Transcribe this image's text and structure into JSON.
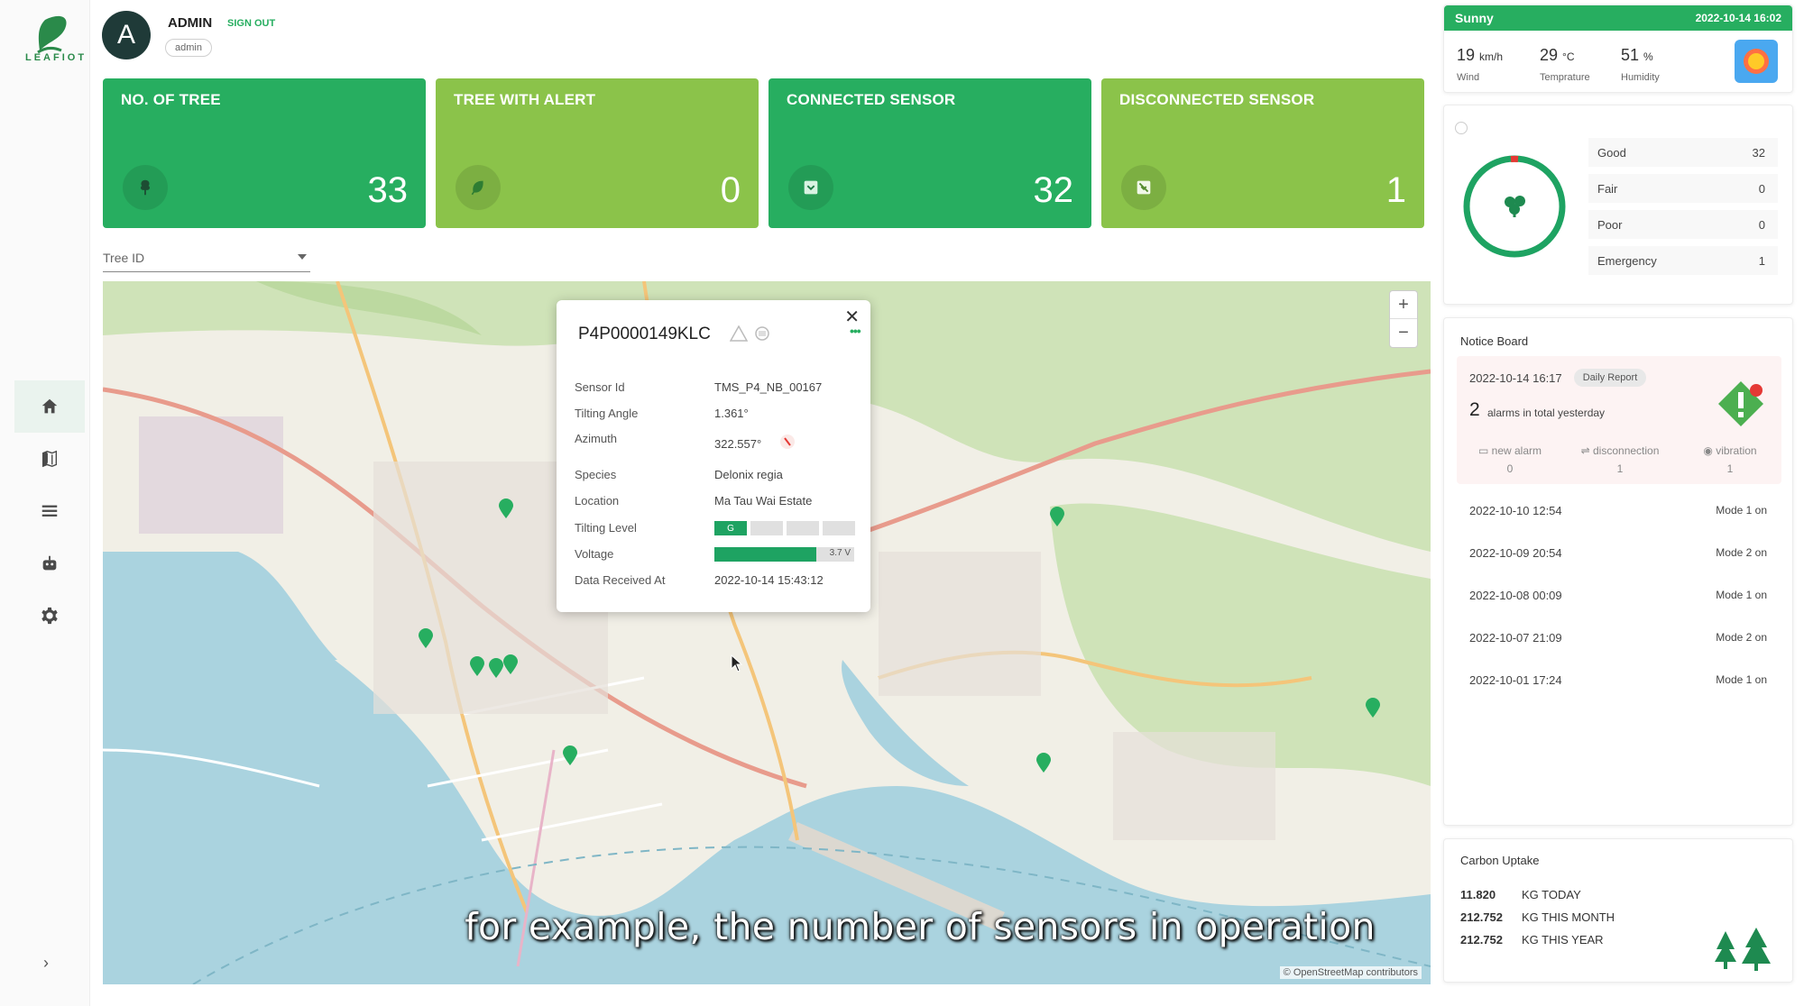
{
  "app": {
    "logo_text": "LEAFIOT"
  },
  "user": {
    "initial": "A",
    "name": "ADMIN",
    "sign_out": "SIGN OUT",
    "role": "admin"
  },
  "nav": [
    {
      "name": "home",
      "icon": "home-icon",
      "active": true
    },
    {
      "name": "map",
      "icon": "map-icon"
    },
    {
      "name": "list",
      "icon": "list-icon"
    },
    {
      "name": "sensor",
      "icon": "robot-icon"
    },
    {
      "name": "settings",
      "icon": "gear-icon"
    }
  ],
  "stats": [
    {
      "title": "NO. OF TREE",
      "value": "33",
      "icon": "tree-icon",
      "tone": "dark"
    },
    {
      "title": "TREE WITH ALERT",
      "value": "0",
      "icon": "leaf-alert-icon",
      "tone": "light"
    },
    {
      "title": "CONNECTED SENSOR",
      "value": "32",
      "icon": "sensor-icon",
      "tone": "dark"
    },
    {
      "title": "DISCONNECTED SENSOR",
      "value": "1",
      "icon": "sensor-off-icon",
      "tone": "light"
    }
  ],
  "tree_select": {
    "label": "Tree ID"
  },
  "map": {
    "zoom_in": "+",
    "zoom_out": "−",
    "attribution": "© OpenStreetMap contributors",
    "popup": {
      "title": "P4P0000149KLC",
      "close": "✕",
      "more": "•••",
      "rows": [
        {
          "label": "Sensor Id",
          "value": "TMS_P4_NB_00167"
        },
        {
          "label": "Tilting Angle",
          "value": "1.361°"
        },
        {
          "label": "Azimuth",
          "value": "322.557°"
        },
        {
          "label": "Species",
          "value": "Delonix regia"
        },
        {
          "label": "Location",
          "value": "Ma Tau Wai Estate"
        },
        {
          "label": "Tilting Level",
          "value": ""
        },
        {
          "label": "Voltage",
          "value": ""
        },
        {
          "label": "Data Received At",
          "value": "2022-10-14 15:43:12"
        }
      ],
      "tilt_level": {
        "segments": [
          "G",
          "",
          "",
          ""
        ],
        "active_index": 0
      },
      "voltage": {
        "value": "3.7 V",
        "fill_fraction": 0.73
      }
    }
  },
  "subtitle": "for example, the number of sensors in operation",
  "weather": {
    "condition": "Sunny",
    "datetime": "2022-10-14 16:02",
    "items": [
      {
        "value": "19",
        "unit": "km/h",
        "label": "Wind"
      },
      {
        "value": "29",
        "unit": "°C",
        "label": "Temprature"
      },
      {
        "value": "51",
        "unit": "%",
        "label": "Humidity"
      }
    ]
  },
  "tree_status": {
    "rows": [
      {
        "label": "Good",
        "value": "32"
      },
      {
        "label": "Fair",
        "value": "0"
      },
      {
        "label": "Poor",
        "value": "0"
      },
      {
        "label": "Emergency",
        "value": "1"
      }
    ]
  },
  "notice_board": {
    "title": "Notice Board",
    "highlight": {
      "time": "2022-10-14 16:17",
      "chip": "Daily Report",
      "count": "2",
      "count_text": "alarms in total yesterday",
      "categories": [
        {
          "label": "new alarm",
          "value": "0"
        },
        {
          "label": "disconnection",
          "value": "1"
        },
        {
          "label": "vibration",
          "value": "1"
        }
      ]
    },
    "entries": [
      {
        "time": "2022-10-10 12:54",
        "mode": "Mode 1 on"
      },
      {
        "time": "2022-10-09 20:54",
        "mode": "Mode 2 on"
      },
      {
        "time": "2022-10-08 00:09",
        "mode": "Mode 1 on"
      },
      {
        "time": "2022-10-07 21:09",
        "mode": "Mode 2 on"
      },
      {
        "time": "2022-10-01 17:24",
        "mode": "Mode 1 on"
      }
    ]
  },
  "carbon": {
    "title": "Carbon Uptake",
    "rows": [
      {
        "value": "11.820",
        "label": "KG TODAY"
      },
      {
        "value": "212.752",
        "label": "KG THIS MONTH"
      },
      {
        "value": "212.752",
        "label": "KG THIS YEAR"
      }
    ]
  },
  "colors": {
    "brand": "#27ae60",
    "light_green": "#8bc34a",
    "alert": "#e53935"
  }
}
